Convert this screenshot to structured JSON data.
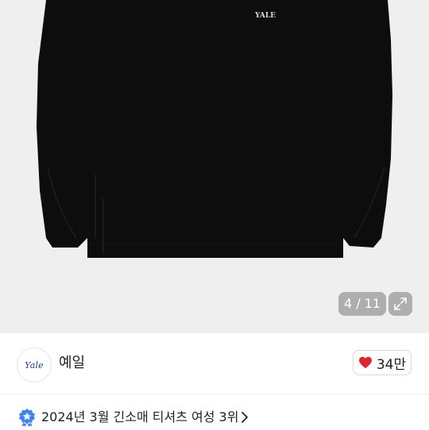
{
  "gallery": {
    "counter": "4 / 11",
    "current_index": 4,
    "total": 11,
    "icons": {
      "expand": "expand-icon"
    }
  },
  "product": {
    "garment_print": "YALE",
    "colors": {
      "garment": "#0d0d0d",
      "background": "#efefef"
    }
  },
  "seller": {
    "logo_text": "Yale",
    "name": "예일",
    "likes": "34만",
    "icons": {
      "like": "heart-icon"
    },
    "colors": {
      "heart": "#e0262c"
    }
  },
  "ranking": {
    "text": "2024년 3월 긴소매 티셔츠 여성 3위",
    "icons": {
      "badge": "ranking-badge-icon",
      "chevron": "chevron-right-icon"
    },
    "colors": {
      "badge": "#3f83f8"
    }
  }
}
